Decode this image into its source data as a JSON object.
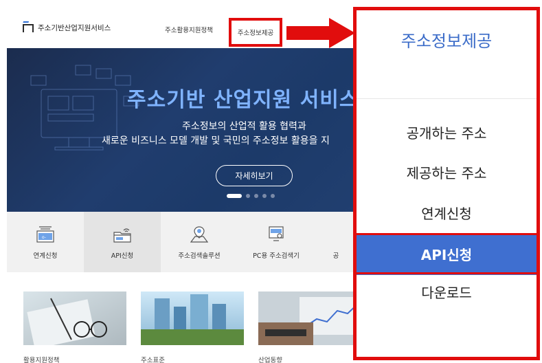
{
  "header": {
    "logo_text": "주소기반산업지원서비스",
    "nav": [
      "주소활용지원정책",
      "주소정보제공"
    ]
  },
  "hero": {
    "title": "주소기반 산업지원 서비스",
    "subtitle_line1": "주소정보의 산업적 활용 협력과",
    "subtitle_line2": "새로운 비즈니스 모델 개발 및 국민의 주소정보 활용을 지",
    "button": "자세히보기",
    "slide_count": 5,
    "active_slide": 1
  },
  "services": [
    {
      "label": "연계신청",
      "icon": "link-server-icon"
    },
    {
      "label": "API신청",
      "icon": "api-folder-icon"
    },
    {
      "label": "주소검색솔루션",
      "icon": "map-pin-icon"
    },
    {
      "label": "PC용 주소검색기",
      "icon": "pc-search-icon"
    },
    {
      "label": "공",
      "icon": ""
    }
  ],
  "thumbnails": [
    {
      "label": "활용지원정책",
      "icon": "glasses-photo"
    },
    {
      "label": "주소표준",
      "icon": "buildings-photo"
    },
    {
      "label": "산업동향",
      "icon": "laptop-photo"
    }
  ],
  "dropdown": {
    "title": "주소정보제공",
    "items": [
      "공개하는 주소",
      "제공하는 주소",
      "연계신청",
      "API신청",
      "다운로드"
    ],
    "active_item": "API신청"
  },
  "colors": {
    "highlight_red": "#e10d0d",
    "accent_blue": "#3f6fd0",
    "hero_bg": "#203d6e",
    "hero_title": "#7fb3ff"
  }
}
